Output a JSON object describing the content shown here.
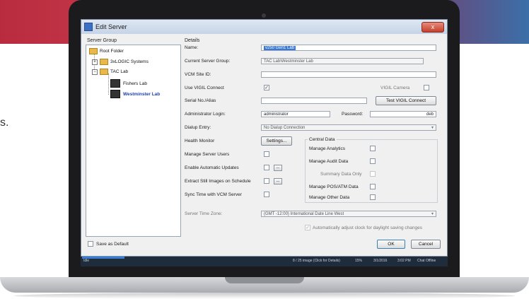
{
  "page": {
    "side_text": "s."
  },
  "window": {
    "title": "Edit Server",
    "close_label": "x"
  },
  "server_group": {
    "label": "Server Group",
    "tree": [
      {
        "label": "Root Folder",
        "type": "folder",
        "expander": ""
      },
      {
        "label": "3xLOGIC Systems",
        "type": "folder",
        "expander": "+"
      },
      {
        "label": "TAC Lab",
        "type": "folder",
        "expander": "−"
      },
      {
        "label": "Fishers Lab",
        "type": "server",
        "expander": ""
      },
      {
        "label": "Westminster Lab",
        "type": "server",
        "expander": "",
        "selected": true
      }
    ],
    "save_default_label": "Save as Default"
  },
  "details": {
    "label": "Details",
    "name_label": "Name:",
    "name_value": "v250 Gen1 Lab",
    "current_group_label": "Current Server Group:",
    "current_group_value": "TAC Lab\\Westminster Lab",
    "vcm_site_label": "VCM Site ID:",
    "vcm_site_value": "",
    "use_vigil_label": "Use VIGIL Connect",
    "use_vigil_checked": "✓",
    "vigil_camera_label": "VIGIL Camera",
    "serial_label": "Serial No./Alias",
    "serial_value": "",
    "test_vigil_label": "Test VIGIL Connect",
    "admin_login_label": "Administrator Login:",
    "admin_login_value": "administrator",
    "password_label": "Password:",
    "password_value": "deb",
    "dialup_label": "Dialup Entry:",
    "dialup_value": "No Dialup Connection",
    "health_monitor_label": "Health Monitor",
    "settings_button": "Settings...",
    "manage_users_label": "Manage Server Users",
    "auto_updates_label": "Enable Automatic Updates",
    "extract_images_label": "Extract Still Images on Schedule",
    "sync_time_label": "Sync Time with VCM Server",
    "ellipsis": "...",
    "central_data": {
      "label": "Central Data",
      "items": [
        {
          "label": "Manage Analytics",
          "disabled": false
        },
        {
          "label": "Manage Audit Data",
          "disabled": false
        },
        {
          "label": "Summary Data Only",
          "disabled": true
        },
        {
          "label": "Manage POS/ATM Data",
          "disabled": false
        },
        {
          "label": "Manage Other Data",
          "disabled": false
        }
      ]
    },
    "timezone_label": "Server Time Zone:",
    "timezone_value": "(GMT -12:00) International Date Line West",
    "dst_label": "Automatically adjust clock for daylight saving changes",
    "dst_checked": "✓"
  },
  "footer": {
    "ok_label": "OK",
    "cancel_label": "Cancel"
  },
  "taskbar": {
    "left_text": "Idle",
    "status_text": "8 / 25 image (Click for Details)",
    "percent_text": "15%",
    "date_text": "3/1/2016",
    "time_text": "3:02 PM",
    "user_text": "Chat Offline"
  },
  "colors": {
    "selection": "#3978d6",
    "link_blue": "#1a3fb0",
    "titlebar": "#c5d4e6"
  }
}
